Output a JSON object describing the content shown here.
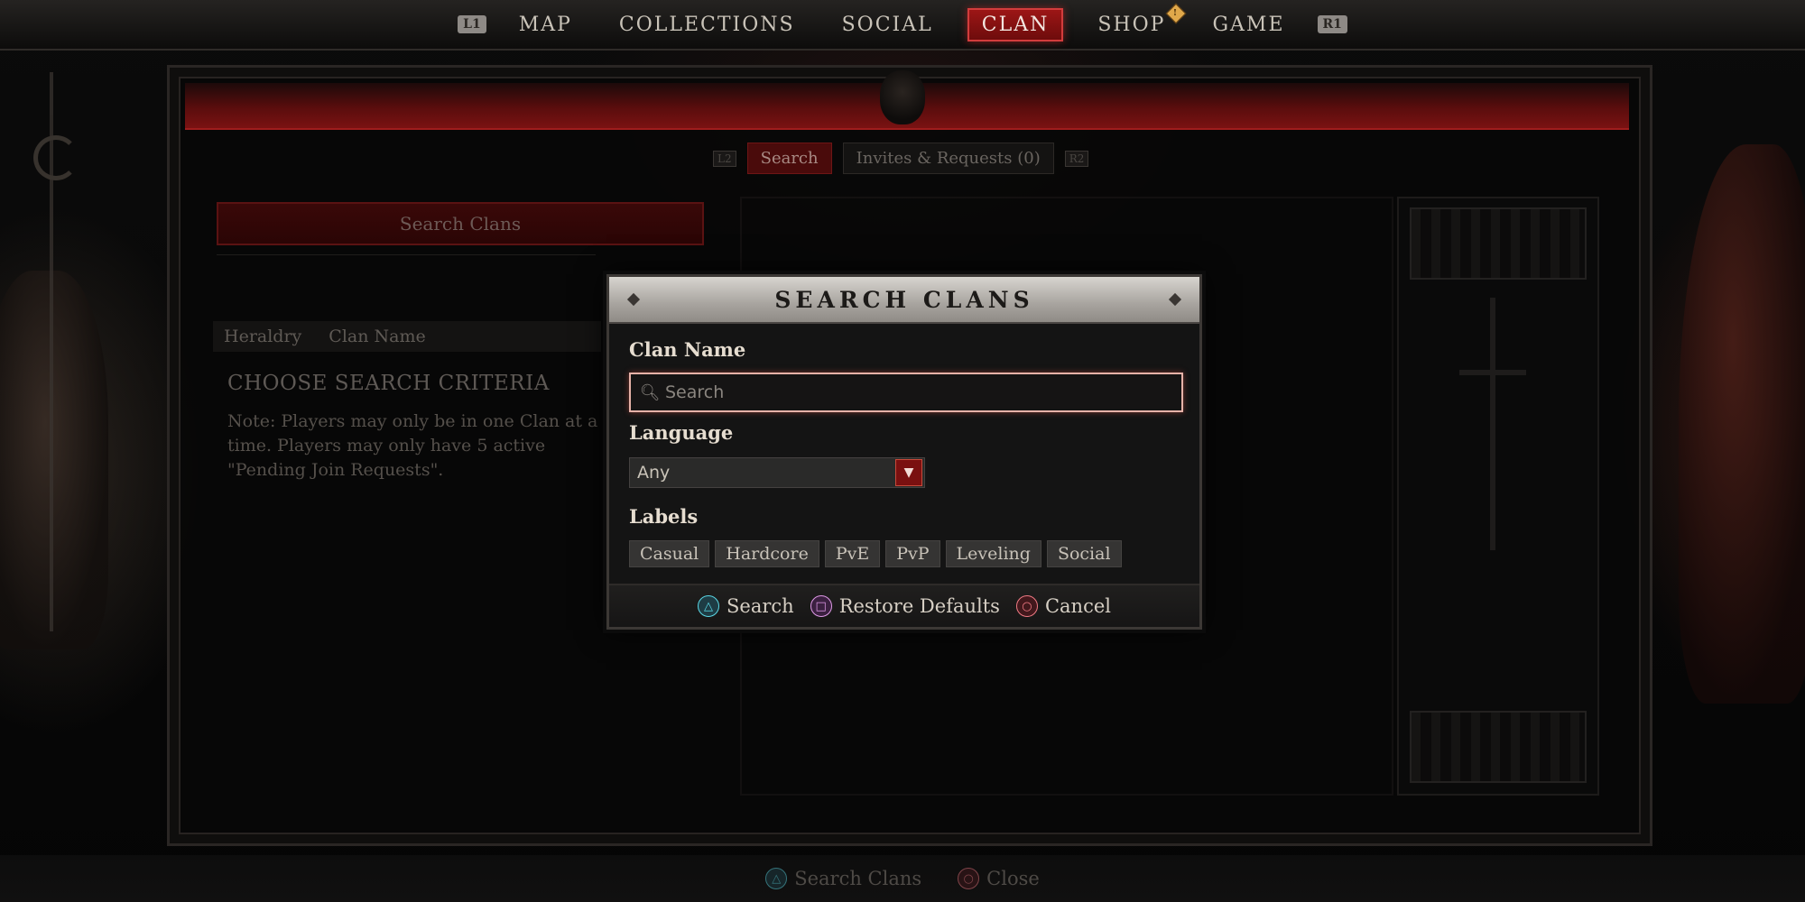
{
  "topnav": {
    "left_bumper": "L1",
    "right_bumper": "R1",
    "items": [
      "MAP",
      "COLLECTIONS",
      "SOCIAL",
      "CLAN",
      "SHOP",
      "GAME"
    ],
    "active": "CLAN",
    "shop_badge": "!"
  },
  "subtabs": {
    "left_bumper": "L2",
    "right_bumper": "R2",
    "search": "Search",
    "invites": "Invites & Requests (0)"
  },
  "left_panel": {
    "search_button": "Search Clans",
    "columns": [
      "Heraldry",
      "Clan Name"
    ],
    "criteria_title": "CHOOSE SEARCH CRITERIA",
    "note": "Note: Players may only be in one Clan at a time. Players may only have 5 active \"Pending Join Requests\"."
  },
  "modal": {
    "title": "SEARCH CLANS",
    "clan_name_label": "Clan Name",
    "search_placeholder": "Search",
    "search_value": "",
    "language_label": "Language",
    "language_value": "Any",
    "labels_label": "Labels",
    "labels": [
      "Casual",
      "Hardcore",
      "PvE",
      "PvP",
      "Leveling",
      "Social"
    ],
    "footer": {
      "search": "Search",
      "restore": "Restore Defaults",
      "cancel": "Cancel"
    }
  },
  "bottombar": {
    "search_clans": "Search Clans",
    "close": "Close"
  },
  "colors": {
    "accent_red": "#9c1616",
    "title_bar": "#c9c5c0",
    "triangle": "#5ad8e6",
    "square": "#e09ae8",
    "circle": "#f07a84"
  }
}
